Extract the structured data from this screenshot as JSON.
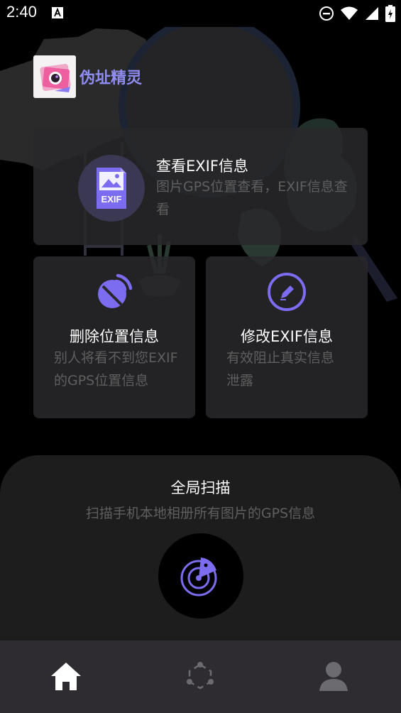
{
  "status_bar": {
    "time": "2:40",
    "icons": [
      "a-notification-icon",
      "do-not-disturb-icon",
      "wifi-icon",
      "signal-icon",
      "battery-icon"
    ]
  },
  "app": {
    "name": "伪址精灵",
    "logo_icon": "camera-app-logo"
  },
  "colors": {
    "accent": "#7b6cf0",
    "title": "#8f8cf3",
    "card_bg": "#28282a",
    "muted_text": "#5f5f60",
    "panel_bg": "#1d1d1e",
    "nav_bg": "#2e2c30"
  },
  "cards": {
    "view_exif": {
      "title": "查看EXIF信息",
      "desc": "图片GPS位置查看，EXIF信息查看",
      "icon": "exif-image-icon",
      "icon_text": "EXIF"
    },
    "delete_location": {
      "title": "删除位置信息",
      "desc": "别人将看不到您EXIF的GPS位置信息",
      "icon": "location-off-icon"
    },
    "modify_exif": {
      "title": "修改EXIF信息",
      "desc": "有效阻止真实信息泄露",
      "icon": "edit-icon"
    }
  },
  "scan": {
    "title": "全局扫描",
    "desc": "扫描手机本地相册所有图片的GPS信息",
    "icon": "radar-scan-icon"
  },
  "bottom_nav": {
    "items": [
      {
        "name": "home",
        "icon": "home-icon",
        "active": true
      },
      {
        "name": "discover",
        "icon": "hexagon-nodes-icon",
        "active": false
      },
      {
        "name": "profile",
        "icon": "user-icon",
        "active": false
      }
    ]
  }
}
